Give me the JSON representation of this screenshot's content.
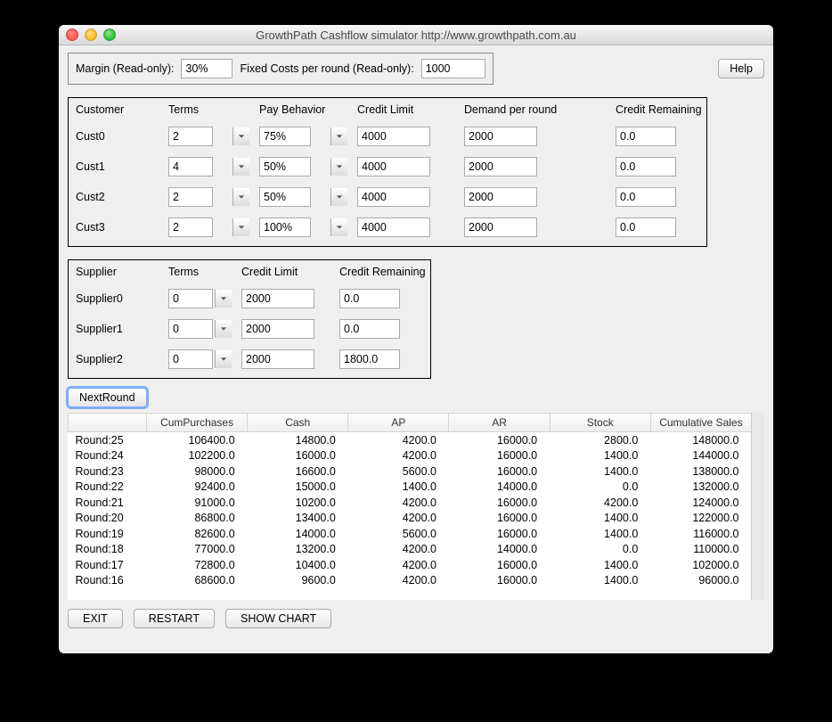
{
  "window": {
    "title": "GrowthPath Cashflow simulator http://www.growthpath.com.au"
  },
  "top": {
    "margin_label": "Margin (Read-only):",
    "margin_value": "30%",
    "fixed_label": "Fixed Costs per round (Read-only):",
    "fixed_value": "1000",
    "help": "Help"
  },
  "customers": {
    "headers": {
      "c0": "Customer",
      "c1": "Terms",
      "c2": "Pay Behavior",
      "c3": "Credit Limit",
      "c4": "Demand per round",
      "c5": "Credit Remaining"
    },
    "rows": [
      {
        "name": "Cust0",
        "terms": "2",
        "pay": "75%",
        "credit_limit": "4000",
        "demand": "2000",
        "remaining": "0.0"
      },
      {
        "name": "Cust1",
        "terms": "4",
        "pay": "50%",
        "credit_limit": "4000",
        "demand": "2000",
        "remaining": "0.0"
      },
      {
        "name": "Cust2",
        "terms": "2",
        "pay": "50%",
        "credit_limit": "4000",
        "demand": "2000",
        "remaining": "0.0"
      },
      {
        "name": "Cust3",
        "terms": "2",
        "pay": "100%",
        "credit_limit": "4000",
        "demand": "2000",
        "remaining": "0.0"
      }
    ]
  },
  "suppliers": {
    "headers": {
      "s0": "Supplier",
      "s1": "Terms",
      "s2": "Credit Limit",
      "s3": "Credit Remaining"
    },
    "rows": [
      {
        "name": "Supplier0",
        "terms": "0",
        "credit_limit": "2000",
        "remaining": "0.0"
      },
      {
        "name": "Supplier1",
        "terms": "0",
        "credit_limit": "2000",
        "remaining": "0.0"
      },
      {
        "name": "Supplier2",
        "terms": "0",
        "credit_limit": "2000",
        "remaining": "1800.0"
      }
    ]
  },
  "buttons": {
    "next_round": "NextRound",
    "exit": "EXIT",
    "restart": "RESTART",
    "show_chart": "SHOW CHART"
  },
  "table": {
    "headers": {
      "blank": "",
      "h1": "CumPurchases",
      "h2": "Cash",
      "h3": "AP",
      "h4": "AR",
      "h5": "Stock",
      "h6": "Cumulative Sales"
    },
    "rows": [
      {
        "round": "Round:25",
        "cp": "106400.0",
        "cash": "14800.0",
        "ap": "4200.0",
        "ar": "16000.0",
        "stock": "2800.0",
        "cs": "148000.0"
      },
      {
        "round": "Round:24",
        "cp": "102200.0",
        "cash": "16000.0",
        "ap": "4200.0",
        "ar": "16000.0",
        "stock": "1400.0",
        "cs": "144000.0"
      },
      {
        "round": "Round:23",
        "cp": "98000.0",
        "cash": "16600.0",
        "ap": "5600.0",
        "ar": "16000.0",
        "stock": "1400.0",
        "cs": "138000.0"
      },
      {
        "round": "Round:22",
        "cp": "92400.0",
        "cash": "15000.0",
        "ap": "1400.0",
        "ar": "14000.0",
        "stock": "0.0",
        "cs": "132000.0"
      },
      {
        "round": "Round:21",
        "cp": "91000.0",
        "cash": "10200.0",
        "ap": "4200.0",
        "ar": "16000.0",
        "stock": "4200.0",
        "cs": "124000.0"
      },
      {
        "round": "Round:20",
        "cp": "86800.0",
        "cash": "13400.0",
        "ap": "4200.0",
        "ar": "16000.0",
        "stock": "1400.0",
        "cs": "122000.0"
      },
      {
        "round": "Round:19",
        "cp": "82600.0",
        "cash": "14000.0",
        "ap": "5600.0",
        "ar": "16000.0",
        "stock": "1400.0",
        "cs": "116000.0"
      },
      {
        "round": "Round:18",
        "cp": "77000.0",
        "cash": "13200.0",
        "ap": "4200.0",
        "ar": "14000.0",
        "stock": "0.0",
        "cs": "110000.0"
      },
      {
        "round": "Round:17",
        "cp": "72800.0",
        "cash": "10400.0",
        "ap": "4200.0",
        "ar": "16000.0",
        "stock": "1400.0",
        "cs": "102000.0"
      },
      {
        "round": "Round:16",
        "cp": "68600.0",
        "cash": "9600.0",
        "ap": "4200.0",
        "ar": "16000.0",
        "stock": "1400.0",
        "cs": "96000.0"
      }
    ]
  }
}
